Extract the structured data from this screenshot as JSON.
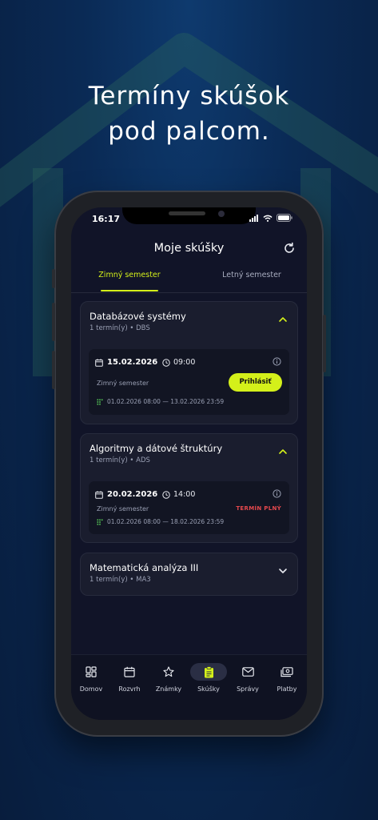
{
  "headline": {
    "line1": "Termíny skúšok",
    "line2": "pod palcom."
  },
  "status_bar": {
    "time": "16:17"
  },
  "header": {
    "title": "Moje skúšky"
  },
  "tabs": [
    {
      "label": "Zimný semester",
      "active": true
    },
    {
      "label": "Letný semester",
      "active": false
    }
  ],
  "courses": [
    {
      "title": "Databázové systémy",
      "subtitle": "1 termín(y) • DBS",
      "expanded": true,
      "slots": [
        {
          "date": "15.02.2026",
          "time": "09:00",
          "semester": "Zimný semester",
          "range": "01.02.2026 08:00 — 13.02.2026 23:59",
          "action_label": "Prihlásiť"
        }
      ]
    },
    {
      "title": "Algoritmy a dátové štruktúry",
      "subtitle": "1 termín(y) • ADS",
      "expanded": true,
      "slots": [
        {
          "date": "20.02.2026",
          "time": "14:00",
          "semester": "Zimný semester",
          "range": "01.02.2026 08:00 — 18.02.2026 23:59",
          "status_label": "TERMÍN PLNÝ"
        }
      ]
    },
    {
      "title": "Matematická analýza III",
      "subtitle": "1 termín(y) • MA3",
      "expanded": false
    }
  ],
  "bottom_nav": [
    {
      "label": "Domov",
      "icon": "dashboard-icon"
    },
    {
      "label": "Rozvrh",
      "icon": "calendar-icon"
    },
    {
      "label": "Známky",
      "icon": "star-icon"
    },
    {
      "label": "Skúšky",
      "icon": "clipboard-icon",
      "active": true
    },
    {
      "label": "Správy",
      "icon": "mail-icon"
    },
    {
      "label": "Platby",
      "icon": "payments-icon"
    }
  ],
  "colors": {
    "accent": "#d4f01a",
    "danger": "#e5484d",
    "screen_bg": "#111428",
    "card_bg": "#1a1d2e"
  }
}
